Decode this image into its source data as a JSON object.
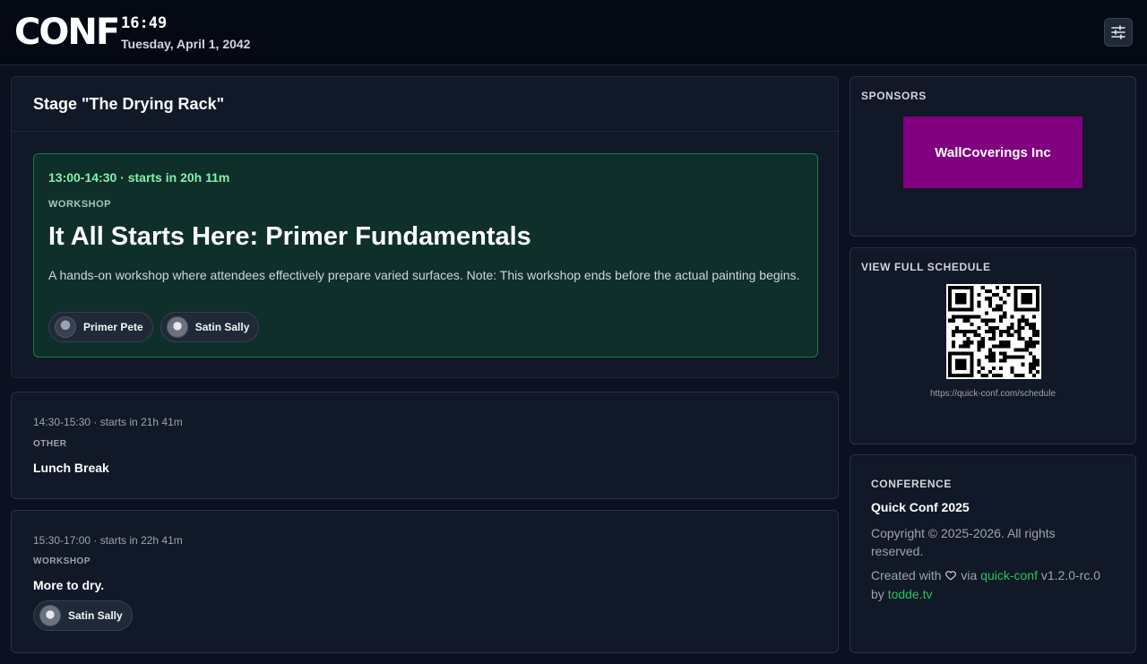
{
  "header": {
    "logo": "CONF",
    "time": "16:49",
    "date": "Tuesday, April 1, 2042",
    "settings_icon": "sliders-icon"
  },
  "stage": {
    "title": "Stage \"The Drying Rack\"",
    "current": {
      "time": "13:00-14:30 · starts in 20h 11m",
      "type": "WORKSHOP",
      "title": "It All Starts Here: Primer Fundamentals",
      "description": "A hands-on workshop where attendees effectively prepare varied surfaces. Note: This workshop ends before the actual painting begins.",
      "speakers": [
        "Primer Pete",
        "Satin Sally"
      ]
    },
    "upcoming": [
      {
        "time": "14:30-15:30 · starts in 21h 41m",
        "type": "OTHER",
        "title": "Lunch Break",
        "speakers": []
      },
      {
        "time": "15:30-17:00 · starts in 22h 41m",
        "type": "WORKSHOP",
        "title": "More to dry.",
        "speakers": [
          "Satin Sally"
        ]
      }
    ]
  },
  "sponsors": {
    "label": "SPONSORS",
    "name": "WallCoverings Inc",
    "color": "#800080"
  },
  "schedule": {
    "label": "VIEW FULL SCHEDULE",
    "url": "https://quick-conf.com/schedule"
  },
  "conference": {
    "label": "CONFERENCE",
    "name": "Quick Conf 2025",
    "copyright": "Copyright © 2025-2026. All rights reserved.",
    "created_prefix": "Created with",
    "via": "via",
    "project_link": "quick-conf",
    "version": "v1.2.0-rc.0",
    "by": "by",
    "author_link": "todde.tv"
  },
  "colors": {
    "accent": "#22c55e",
    "current_bg": "#0f2f2a"
  }
}
